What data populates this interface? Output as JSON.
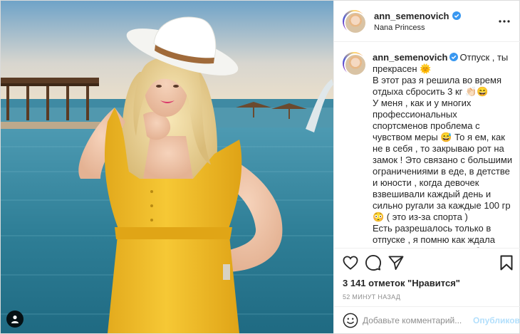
{
  "header": {
    "username": "ann_semenovich",
    "location": "Nana Princess"
  },
  "caption": {
    "username": "ann_semenovich",
    "text": "Отпуск , ты прекрасен 🌞\nВ этот раз я решила во время отдыха сбросить 3 кг 👏🏻😄\nУ меня , как и у многих профессиональных спортсменов проблема с чувством меры 😅 То я ем, как не в себя , то закрываю рот на замок ! Это связано с большими ограничениями в еде, в детстве и юности , когда девочек взвешивали каждый день и сильно ругали за каждые 100 гр 😳 ( это из-за спорта )\nЕсть разрешалось только в отпуске , я помню как ждала этот отпуск, именно чтоб поесть и не чувствовать вечный голод с которым живешь ежедневно 😞\nЭто был месяц обжорства , я могла"
  },
  "stats": {
    "likes": "3 141 отметок \"Нравится\"",
    "time_ago": "52 минут назад"
  },
  "comment_box": {
    "placeholder": "Добавьте комментарий...",
    "post_label": "Опубликовать"
  },
  "icons": {
    "verified": "verified-badge-icon",
    "more": "more-options-icon",
    "like": "heart-icon",
    "comment": "comment-bubble-icon",
    "share": "paper-plane-icon",
    "save": "bookmark-icon",
    "emoji": "smiley-icon",
    "tags": "user-tag-icon"
  },
  "colors": {
    "verified": "#3897f0",
    "post_disabled": "#b2dffc",
    "muted": "#8e8e8e",
    "text": "#262626",
    "dress": "#f2c230",
    "sea": "#3e8fa6"
  }
}
